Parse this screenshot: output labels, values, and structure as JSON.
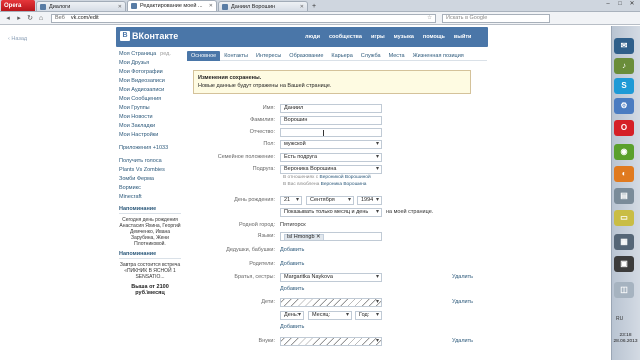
{
  "browser": {
    "opera_label": "Opera",
    "tabs": [
      {
        "title": "Диалоги",
        "active": false
      },
      {
        "title": "Редактирование моей ...",
        "active": true
      },
      {
        "title": "Даниил Ворошин",
        "active": false
      }
    ],
    "url_prefix": "Веб",
    "url": "vk.com/edit",
    "search_placeholder": "Искать в Google"
  },
  "vk": {
    "logo_text": "ВКонтакте",
    "logo_letter": "В",
    "back_link": "Назад",
    "top_nav": [
      "люди",
      "сообщества",
      "игры",
      "музыка",
      "помощь",
      "выйти"
    ],
    "left_menu": [
      "Моя Страница",
      "Мои Друзья",
      "Мои Фотографии",
      "Мои Видеозаписи",
      "Мои Аудиозаписи",
      "Мои Сообщения",
      "Мои Группы",
      "Мои Новости",
      "Мои Закладки",
      "Мои Настройки"
    ],
    "edit_label": "ред.",
    "apps_menu": [
      "Приложения +1033",
      "Получить голоса",
      "Plants Vs Zombies",
      "Зомби Ферма",
      "Вормикс",
      "Minecraft"
    ],
    "ads": [
      {
        "head": "Напоминание",
        "text": "Сегодня день рождения Анастасия Яхина, Георгий Демченко, Ивана Зарубина, Жени Плотниковой."
      },
      {
        "head": "Напоминание",
        "text": "Завтра состоится встреча «ПИКНИК В ЯСНОЙ 1 SENSATIO..."
      },
      {
        "head": "Выша от 2100 руб.\\месяц",
        "text": ""
      }
    ],
    "edit_tabs": [
      "Основное",
      "Контакты",
      "Интересы",
      "Образование",
      "Карьера",
      "Служба",
      "Места",
      "Жизненная позиция"
    ],
    "notice": {
      "title": "Изменения сохранены.",
      "text": "Новые данные будут отражены на Вашей странице."
    },
    "form": {
      "first_name_label": "Имя:",
      "first_name": "Даниил",
      "last_name_label": "Фамилия:",
      "last_name": "Ворошин",
      "patronymic_label": "Отчество:",
      "patronymic": "",
      "sex_label": "Пол:",
      "sex": "мужской",
      "marital_label": "Семейное положение:",
      "marital": "Есть подруга",
      "partner_label": "Подруга:",
      "partner": "Вероника Ворошина",
      "partner_note_1": "В отношениях с",
      "partner_note_1_name": "Вероникой Ворошиной",
      "partner_note_2": "В Вас влюблена",
      "partner_note_2_name": "Вероника Ворошина",
      "birthday_label": "День рождения:",
      "day": "21",
      "month": "Сентября",
      "year": "1994",
      "birthday_visibility": "Показывать только месяц и день",
      "birthday_visibility_suffix": "на моей странице.",
      "hometown_label": "Родной город:",
      "hometown": "Пятигорск",
      "languages_label": "Языки:",
      "language_token": "lsl Hmongb",
      "grandparents_label": "Дедушки, бабушки:",
      "parents_label": "Родители:",
      "siblings_label": "Братья, сестры:",
      "sibling": "Margaritka Naykova",
      "children_label": "Дети:",
      "child_day": "День:",
      "child_month": "Месяц:",
      "child_year": "Год:",
      "grandchildren_label": "Внуки:",
      "add_link": "Добавить",
      "delete_link": "Удалить"
    }
  },
  "system": {
    "lang": "RU",
    "time": "23:18",
    "date": "28.06.2013"
  }
}
